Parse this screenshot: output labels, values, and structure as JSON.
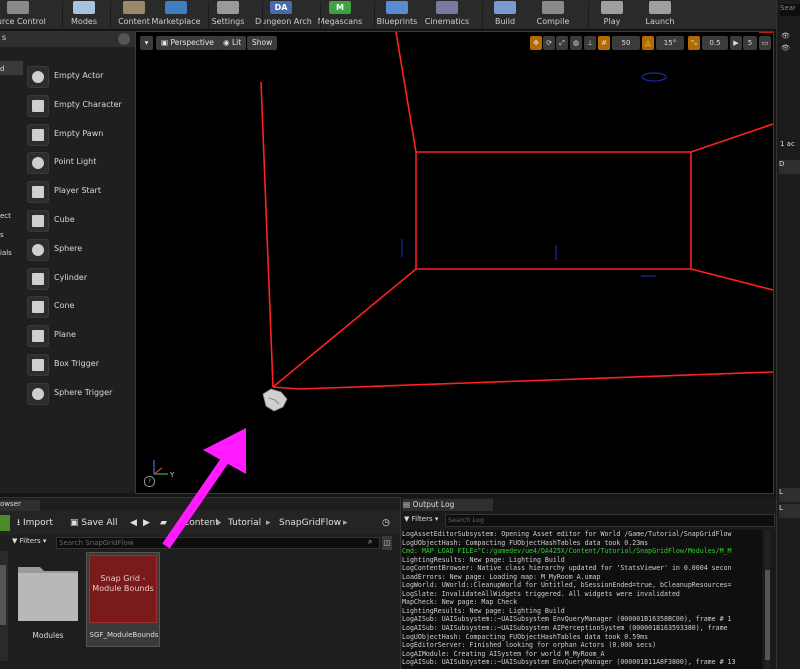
{
  "toolbar": {
    "items": [
      {
        "label": "ource Control",
        "icon": "source-control-icon",
        "color": "#8a8a8a"
      },
      {
        "label": "Modes",
        "icon": "modes-icon",
        "color": "#a9c2e0"
      },
      {
        "label": "Content",
        "icon": "content-icon",
        "color": "#9a8a6a"
      },
      {
        "label": "Marketplace",
        "icon": "marketplace-icon",
        "color": "#3f7fc0"
      },
      {
        "label": "Settings",
        "icon": "settings-icon",
        "color": "#9a9a9a"
      },
      {
        "label": "Dungeon Arch",
        "icon": "dungeon-arch-icon",
        "color": "#4a6ab0",
        "glyph": "DA"
      },
      {
        "label": "Megascans",
        "icon": "megascans-icon",
        "color": "#3fa23f",
        "glyph": "M"
      },
      {
        "label": "Blueprints",
        "icon": "blueprints-icon",
        "color": "#5a8ad0"
      },
      {
        "label": "Cinematics",
        "icon": "cinematics-icon",
        "color": "#7a7aa0"
      },
      {
        "label": "Build",
        "icon": "build-icon",
        "color": "#7a9ad0"
      },
      {
        "label": "Compile",
        "icon": "compile-icon",
        "color": "#8a8a8a"
      },
      {
        "label": "Play",
        "icon": "play-icon",
        "color": "#a0a0a0"
      },
      {
        "label": "Launch",
        "icon": "launch-icon",
        "color": "#a0a0a0"
      }
    ]
  },
  "left_panel": {
    "tab_fragment": "s",
    "categories": [
      "d",
      "ect",
      "s",
      "ials"
    ],
    "items": [
      {
        "label": "Empty Actor",
        "icon": "empty-actor-icon"
      },
      {
        "label": "Empty Character",
        "icon": "empty-character-icon"
      },
      {
        "label": "Empty Pawn",
        "icon": "empty-pawn-icon"
      },
      {
        "label": "Point Light",
        "icon": "point-light-icon"
      },
      {
        "label": "Player Start",
        "icon": "player-start-icon"
      },
      {
        "label": "Cube",
        "icon": "cube-icon"
      },
      {
        "label": "Sphere",
        "icon": "sphere-icon"
      },
      {
        "label": "Cylinder",
        "icon": "cylinder-icon"
      },
      {
        "label": "Cone",
        "icon": "cone-icon"
      },
      {
        "label": "Plane",
        "icon": "plane-icon"
      },
      {
        "label": "Box Trigger",
        "icon": "box-trigger-icon"
      },
      {
        "label": "Sphere Trigger",
        "icon": "sphere-trigger-icon"
      }
    ]
  },
  "viewport": {
    "perspective_label": "Perspective",
    "lit_label": "Lit",
    "show_label": "Show",
    "grid_snap_value": "50",
    "rotation_snap_value": "15°",
    "scale_snap_value": "0.5",
    "camera_speed_value": "5",
    "axis_y_label": "Y",
    "bounds_color": "#ff2020"
  },
  "right_panel": {
    "search_fragment": "Sear",
    "count_fragment": "1 ac",
    "tab_fragment": "D",
    "tab2_fragment": "L",
    "tab3_fragment": "L"
  },
  "content_browser": {
    "tab_fragment": "owser",
    "import_label": "Import",
    "save_all_label": "Save All",
    "breadcrumb": [
      "Content",
      "Tutorial",
      "SnapGridFlow"
    ],
    "filters_label": "Filters",
    "search_placeholder": "Search SnapGridFlow",
    "assets": [
      {
        "label": "Modules",
        "thumb_text": ""
      },
      {
        "label": "SGF_ModuleBounds",
        "thumb_text": "Snap Grid - Module Bounds"
      }
    ]
  },
  "output_log": {
    "tab_label": "Output Log",
    "filters_label": "Filters",
    "search_placeholder": "Search Log",
    "lines": [
      {
        "text": "LogAssetEditorSubsystem: Opening Asset editor for World /Game/Tutorial/SnapGridFlow",
        "color": "#cfcfcf"
      },
      {
        "text": "LogUObjectHash: Compacting FUObjectHashTables data took   0.23ms",
        "color": "#cfcfcf"
      },
      {
        "text": "Cmd: MAP LOAD FILE=\"C:/gamedev/ue4/DA425X/Content/Tutorial/SnapGridFlow/Modules/M_M",
        "color": "#33cc33"
      },
      {
        "text": "LightingResults: New page: Lighting Build",
        "color": "#cfcfcf"
      },
      {
        "text": "LogContentBrowser: Native class hierarchy updated for 'StatsViewer' in 0.0004 secon",
        "color": "#cfcfcf"
      },
      {
        "text": "LoadErrors: New page: Loading map: M_MyRoom_A.umap",
        "color": "#cfcfcf"
      },
      {
        "text": "LogWorld: UWorld::CleanupWorld for Untitled, bSessionEnded=true, bCleanupResources=",
        "color": "#cfcfcf"
      },
      {
        "text": "LogSlate: InvalidateAllWidgets triggered.  All widgets were invalidated",
        "color": "#cfcfcf"
      },
      {
        "text": "MapCheck: New page: Map Check",
        "color": "#cfcfcf"
      },
      {
        "text": "LightingResults: New page: Lighting Build",
        "color": "#cfcfcf"
      },
      {
        "text": "LogAISub: UAISubsystem::~UAISubsystem EnvQueryManager (000001B16358BC00), frame # 1",
        "color": "#cfcfcf"
      },
      {
        "text": "LogAISub: UAISubsystem::~UAISubsystem AIPerceptionSystem (000001B163593380), frame",
        "color": "#cfcfcf"
      },
      {
        "text": "LogUObjectHash: Compacting FUObjectHashTables data took   0.59ms",
        "color": "#cfcfcf"
      },
      {
        "text": "LogEditorServer: Finished looking for orphan Actors (0.000 secs)",
        "color": "#cfcfcf"
      },
      {
        "text": "LogAIModule: Creating AISystem for world M_MyRoom_A",
        "color": "#cfcfcf"
      },
      {
        "text": "LogAISub: UAISubsystem::~UAISubsystem EnvQueryManager (000001B11A8F3800), frame # 13",
        "color": "#cfcfcf"
      }
    ]
  },
  "annotation": {
    "arrow_color": "#ff1aff"
  }
}
